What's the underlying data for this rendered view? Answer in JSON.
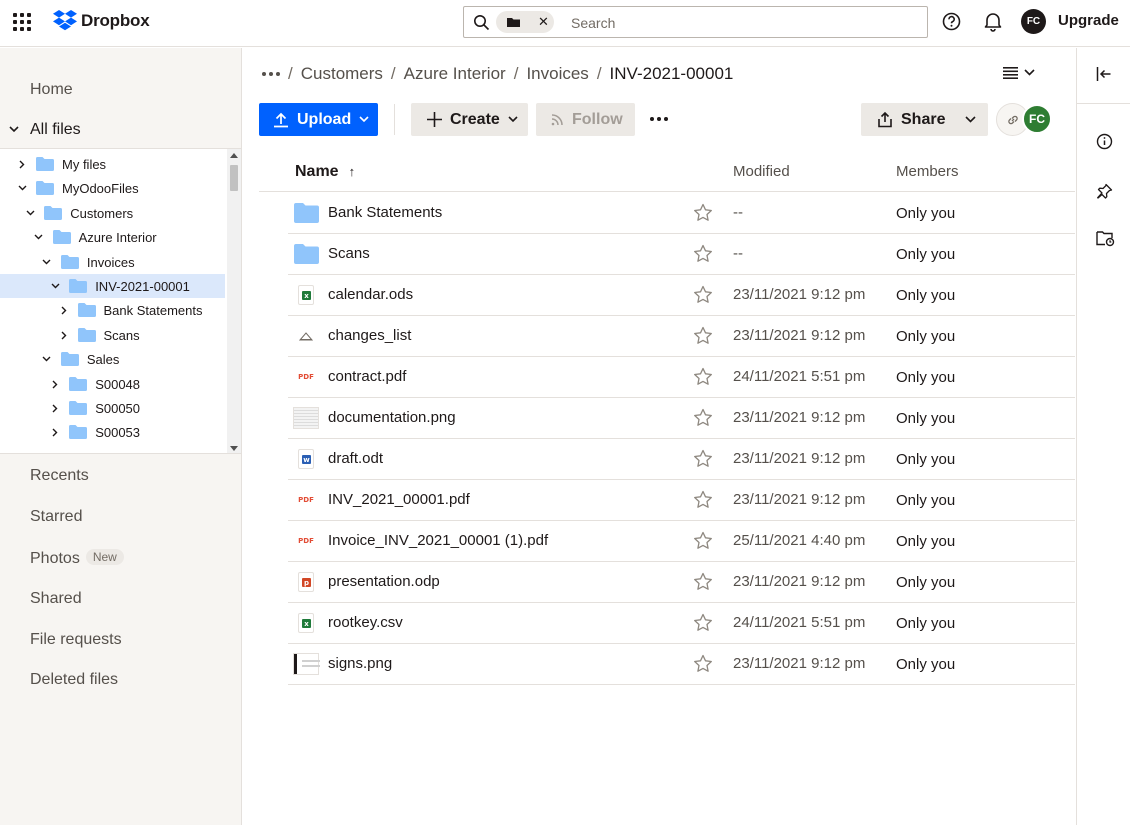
{
  "topbar": {
    "logo_text": "Dropbox",
    "search_placeholder": "Search",
    "avatar_initials": "FC",
    "upgrade_label": "Upgrade"
  },
  "sidebar": {
    "home": "Home",
    "all_files": "All files",
    "tree": [
      {
        "label": "My files",
        "depth": 0,
        "expanded": false,
        "selected": false
      },
      {
        "label": "MyOdooFiles",
        "depth": 0,
        "expanded": true,
        "selected": false
      },
      {
        "label": "Customers",
        "depth": 1,
        "expanded": true,
        "selected": false
      },
      {
        "label": "Azure Interior",
        "depth": 2,
        "expanded": true,
        "selected": false
      },
      {
        "label": "Invoices",
        "depth": 3,
        "expanded": true,
        "selected": false
      },
      {
        "label": "INV-2021-00001",
        "depth": 4,
        "expanded": true,
        "selected": true
      },
      {
        "label": "Bank Statements",
        "depth": 5,
        "expanded": false,
        "selected": false
      },
      {
        "label": "Scans",
        "depth": 5,
        "expanded": false,
        "selected": false
      },
      {
        "label": "Sales",
        "depth": 3,
        "expanded": true,
        "selected": false
      },
      {
        "label": "S00048",
        "depth": 4,
        "expanded": false,
        "selected": false
      },
      {
        "label": "S00050",
        "depth": 4,
        "expanded": false,
        "selected": false
      },
      {
        "label": "S00053",
        "depth": 4,
        "expanded": false,
        "selected": false
      }
    ],
    "recents": "Recents",
    "starred": "Starred",
    "photos": "Photos",
    "photos_badge": "New",
    "shared": "Shared",
    "file_requests": "File requests",
    "deleted_files": "Deleted files"
  },
  "breadcrumb": {
    "items": [
      "Customers",
      "Azure Interior",
      "Invoices"
    ],
    "current": "INV-2021-00001"
  },
  "toolbar": {
    "upload": "Upload",
    "create": "Create",
    "follow": "Follow",
    "share": "Share",
    "member_initials": "FC"
  },
  "table": {
    "col_name": "Name",
    "col_modified": "Modified",
    "col_members": "Members",
    "rows": [
      {
        "name": "Bank Statements",
        "type": "folder",
        "modified": "--",
        "members": "Only you"
      },
      {
        "name": "Scans",
        "type": "folder",
        "modified": "--",
        "members": "Only you"
      },
      {
        "name": "calendar.ods",
        "type": "sheet",
        "modified": "23/11/2021 9:12 pm",
        "members": "Only you"
      },
      {
        "name": "changes_list",
        "type": "generic",
        "modified": "23/11/2021 9:12 pm",
        "members": "Only you"
      },
      {
        "name": "contract.pdf",
        "type": "pdf",
        "modified": "24/11/2021 5:51 pm",
        "members": "Only you"
      },
      {
        "name": "documentation.png",
        "type": "image",
        "modified": "23/11/2021 9:12 pm",
        "members": "Only you"
      },
      {
        "name": "draft.odt",
        "type": "doc",
        "modified": "23/11/2021 9:12 pm",
        "members": "Only you"
      },
      {
        "name": "INV_2021_00001.pdf",
        "type": "pdf",
        "modified": "23/11/2021 9:12 pm",
        "members": "Only you"
      },
      {
        "name": "Invoice_INV_2021_00001 (1).pdf",
        "type": "pdf",
        "modified": "25/11/2021 4:40 pm",
        "members": "Only you"
      },
      {
        "name": "presentation.odp",
        "type": "slides",
        "modified": "23/11/2021 9:12 pm",
        "members": "Only you"
      },
      {
        "name": "rootkey.csv",
        "type": "sheet",
        "modified": "24/11/2021 5:51 pm",
        "members": "Only you"
      },
      {
        "name": "signs.png",
        "type": "image-dark",
        "modified": "23/11/2021 9:12 pm",
        "members": "Only you"
      }
    ]
  },
  "colors": {
    "accent": "#0061fe",
    "folder": "#90c5fb",
    "sheet": "#1f7a3a",
    "doc": "#2b5fb4",
    "slides": "#d24726",
    "pdf": "#e24c35"
  }
}
